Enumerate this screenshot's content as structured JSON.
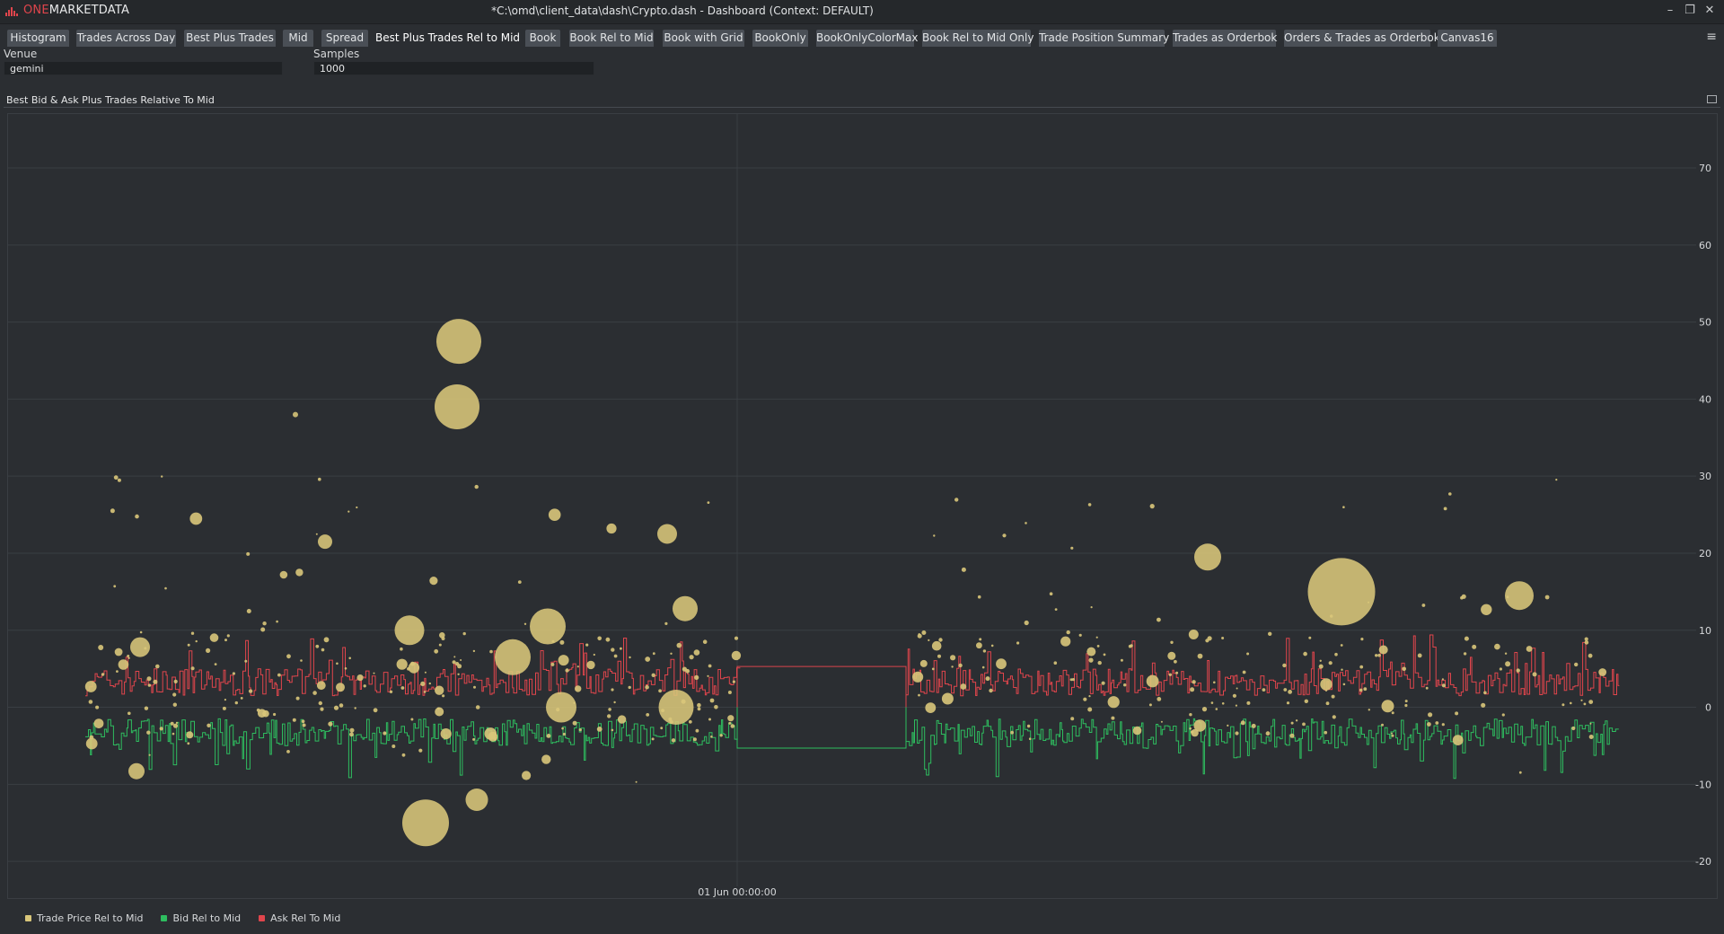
{
  "window": {
    "logo_one": "ONE",
    "logo_rest": "MARKETDATA",
    "title": "*C:\\omd\\client_data\\dash\\Crypto.dash - Dashboard (Context: DEFAULT)",
    "controls": [
      "–",
      "❐",
      "✕"
    ]
  },
  "tabs": [
    {
      "label": "Histogram"
    },
    {
      "label": "Trades Across Day"
    },
    {
      "label": "Best Plus Trades"
    },
    {
      "label": "Mid"
    },
    {
      "label": "Spread"
    },
    {
      "label": "Best Plus Trades Rel to Mid",
      "active": true
    },
    {
      "label": "Book"
    },
    {
      "label": "Book Rel to Mid"
    },
    {
      "label": "Book with Grid"
    },
    {
      "label": "BookOnly"
    },
    {
      "label": "BookOnlyColorMax"
    },
    {
      "label": "Book Rel to Mid Only"
    },
    {
      "label": "Trade Position Summary"
    },
    {
      "label": "Trades as Orderbok"
    },
    {
      "label": "Orders & Trades as Orderbok"
    },
    {
      "label": "Canvas16"
    }
  ],
  "menu_icon": "≡",
  "params": {
    "venue_label": "Venue",
    "venue_value": "gemini",
    "samples_label": "Samples",
    "samples_value": "1000"
  },
  "panel": {
    "title": "Best Bid & Ask Plus Trades Relative To Mid",
    "maximize_icon": "maximize-icon"
  },
  "chart_data": {
    "type": "scatter",
    "title": "Best Bid & Ask Plus Trades Relative To Mid",
    "x_tick_labels": [
      "01 Jun 00:00:00"
    ],
    "y_ticks": [
      70,
      60,
      50,
      40,
      30,
      20,
      10,
      0,
      -10,
      -20
    ],
    "ylim": [
      -25,
      77
    ],
    "grid": true,
    "legend_position": "bottom-left",
    "colors": {
      "trade": "#d9c77a",
      "bid": "#2ebd5f",
      "ask": "#e0454c",
      "grid": "#3a3e43",
      "gap_ask": "#d8454c",
      "gap_bid": "#2ebd5f"
    },
    "series": [
      {
        "name": "Trade Price Rel to Mid",
        "color": "#d9c77a"
      },
      {
        "name": "Bid Rel to Mid",
        "color": "#2ebd5f"
      },
      {
        "name": "Ask Rel To Mid",
        "color": "#e0454c"
      }
    ],
    "gap_block": {
      "ask": 5.3,
      "bid": -5.3
    },
    "large_trades": [
      {
        "y": 47.5,
        "size": 5
      },
      {
        "y": 39,
        "size": 5
      },
      {
        "y": -15,
        "size": 5.2
      },
      {
        "y": 15,
        "size": 7.5
      },
      {
        "y": 19.5,
        "size": 3
      },
      {
        "y": 14.5,
        "size": 3.2
      },
      {
        "y": 10,
        "size": 3.3
      },
      {
        "y": 10.5,
        "size": 4
      },
      {
        "y": 6.5,
        "size": 4
      },
      {
        "y": 12.8,
        "size": 2.8
      },
      {
        "y": 0,
        "size": 3.9
      },
      {
        "y": 0,
        "size": 3.4
      },
      {
        "y": -12,
        "size": 2.5
      },
      {
        "y": 22.5,
        "size": 2.2
      },
      {
        "y": 21.5,
        "size": 1.6
      },
      {
        "y": 38,
        "size": 0.6
      },
      {
        "y": 7.8,
        "size": 2.2
      },
      {
        "y": -8.3,
        "size": 1.8
      }
    ]
  }
}
